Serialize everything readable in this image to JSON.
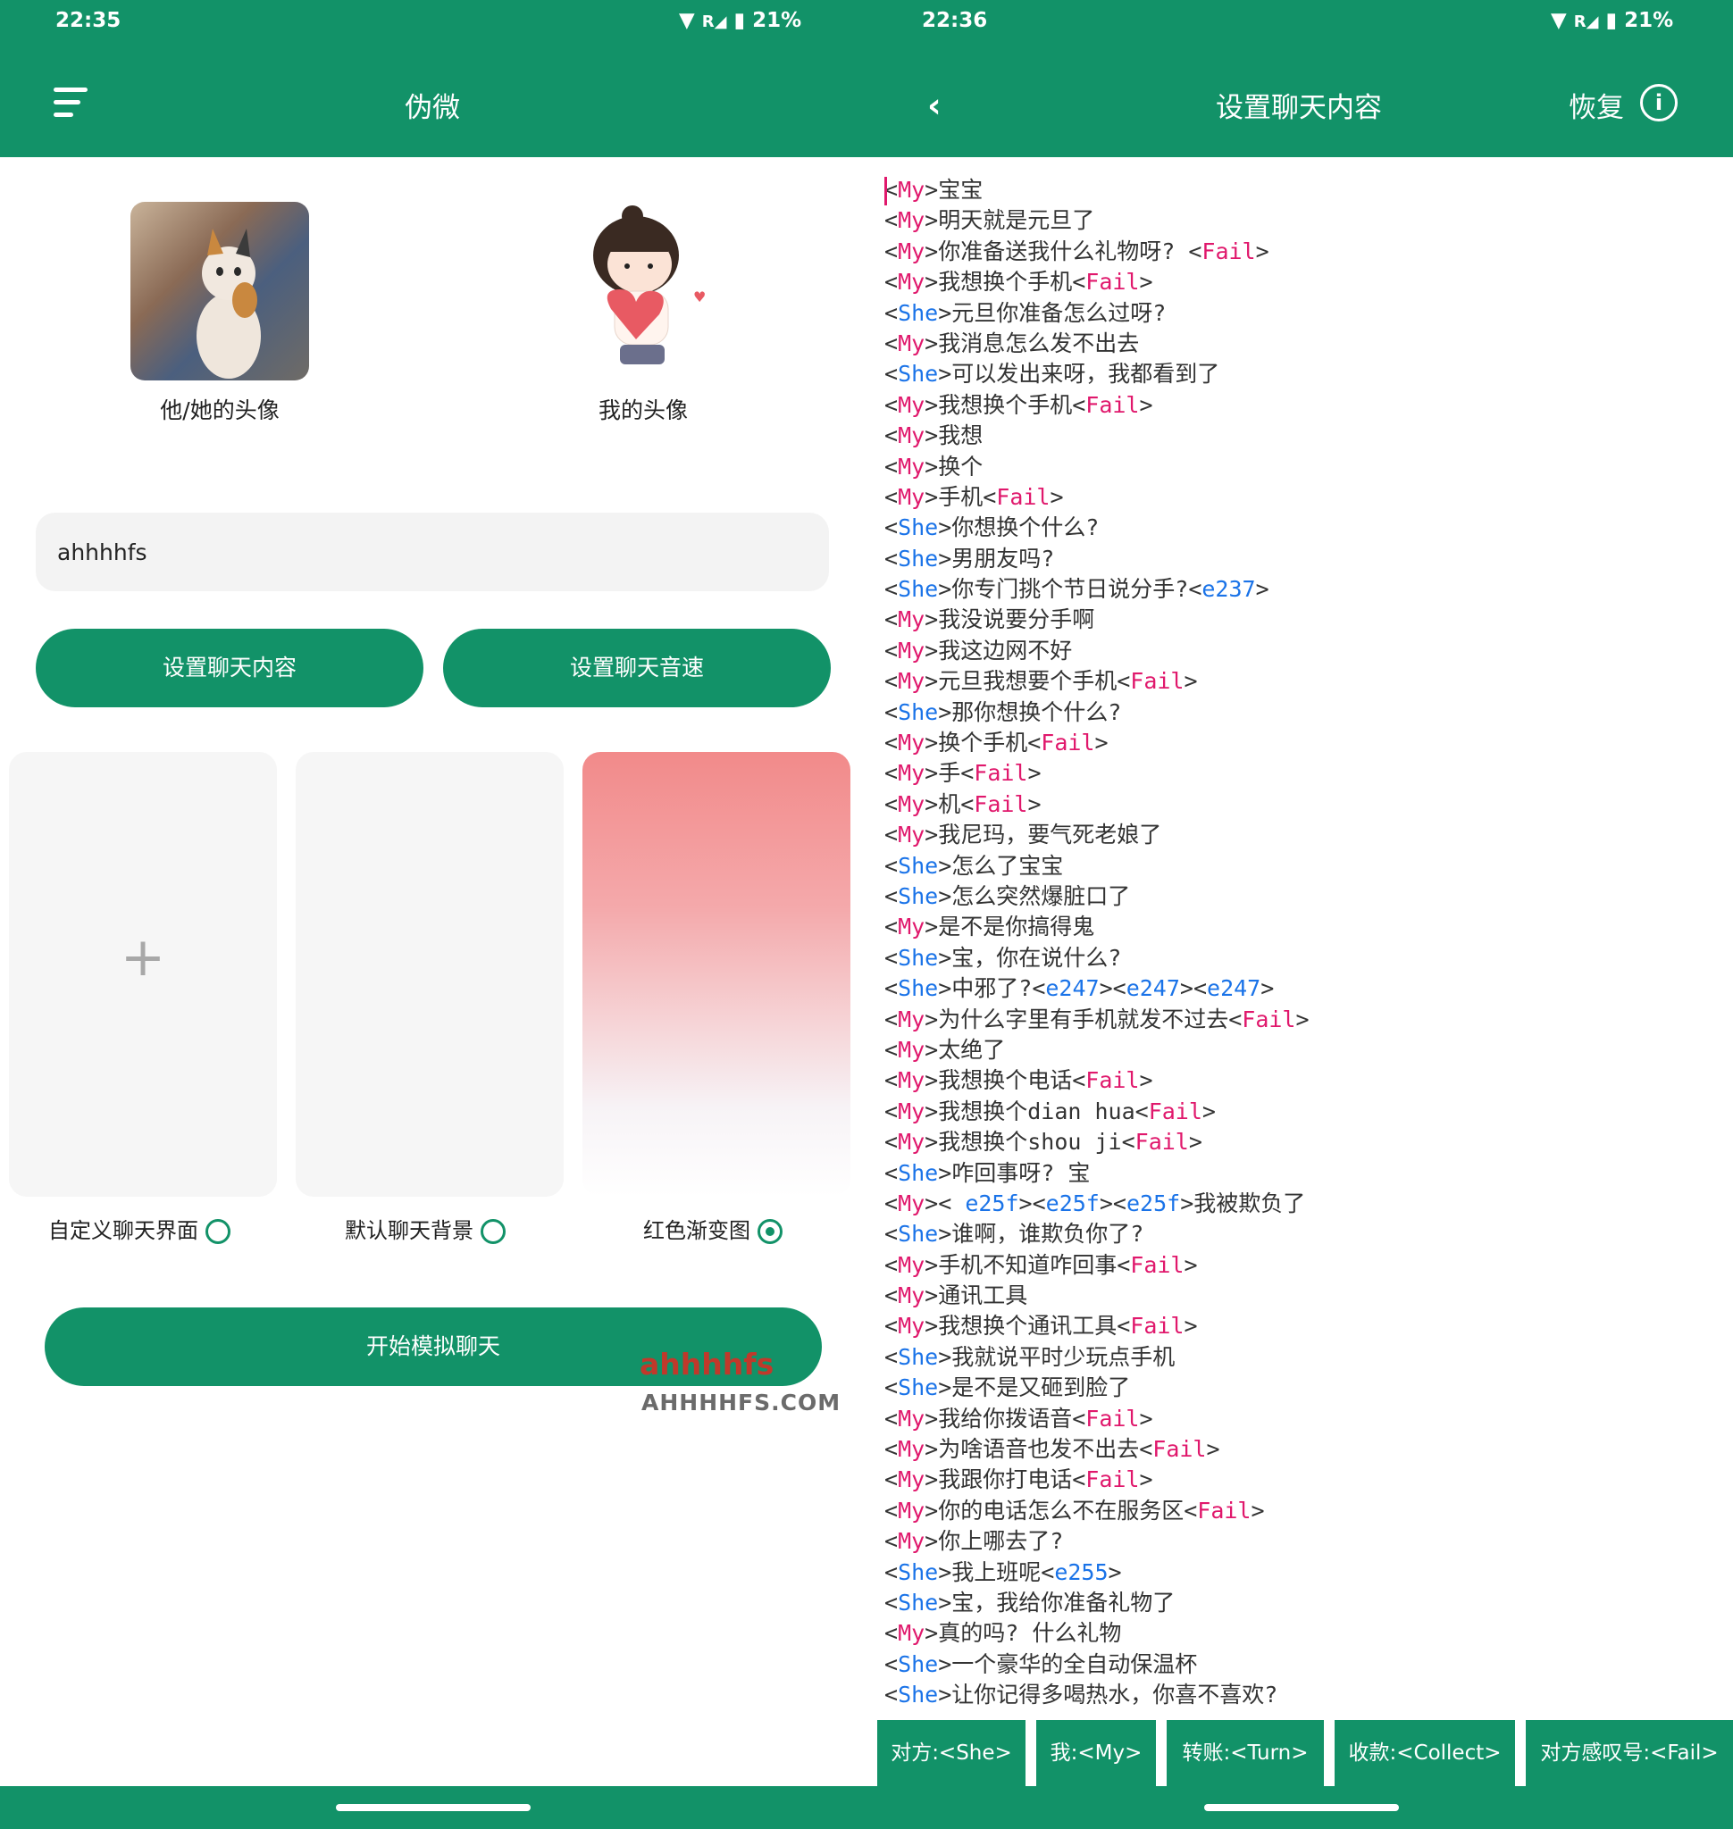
{
  "left": {
    "status_time": "22:35",
    "battery": "21%",
    "title": "伪微",
    "her_avatar_caption": "他/她的头像",
    "my_avatar_caption": "我的头像",
    "name_input_value": "ahhhhfs",
    "btn_set_content": "设置聊天内容",
    "btn_set_speed": "设置聊天音速",
    "card_custom_plus": "+",
    "opt_custom": "自定义聊天界面",
    "opt_default": "默认聊天背景",
    "opt_red": "红色渐变图",
    "selected_option": "红色渐变图",
    "btn_start": "开始模拟聊天",
    "watermark_logo": "ahhhhfs",
    "watermark_url": "AHHHHFS.COM"
  },
  "right": {
    "status_time": "22:36",
    "battery": "21%",
    "title": "设置聊天内容",
    "restore": "恢复",
    "lines": [
      [
        [
          "t",
          "<"
        ],
        [
          "My",
          "My"
        ],
        [
          "t",
          ">宝宝"
        ]
      ],
      [
        [
          "t",
          "<"
        ],
        [
          "My",
          "My"
        ],
        [
          "t",
          ">明天就是元旦了"
        ]
      ],
      [
        [
          "t",
          "<"
        ],
        [
          "My",
          "My"
        ],
        [
          "t",
          ">你准备送我什么礼物呀? <"
        ],
        [
          "Fail",
          "Fail"
        ],
        [
          "t",
          ">"
        ]
      ],
      [
        [
          "t",
          "<"
        ],
        [
          "My",
          "My"
        ],
        [
          "t",
          ">我想换个手机<"
        ],
        [
          "Fail",
          "Fail"
        ],
        [
          "t",
          ">"
        ]
      ],
      [
        [
          "t",
          "<"
        ],
        [
          "She",
          "She"
        ],
        [
          "t",
          ">元旦你准备怎么过呀?"
        ]
      ],
      [
        [
          "t",
          "<"
        ],
        [
          "My",
          "My"
        ],
        [
          "t",
          ">我消息怎么发不出去"
        ]
      ],
      [
        [
          "t",
          "<"
        ],
        [
          "She",
          "She"
        ],
        [
          "t",
          ">可以发出来呀，我都看到了"
        ]
      ],
      [
        [
          "t",
          "<"
        ],
        [
          "My",
          "My"
        ],
        [
          "t",
          ">我想换个手机<"
        ],
        [
          "Fail",
          "Fail"
        ],
        [
          "t",
          ">"
        ]
      ],
      [
        [
          "t",
          "<"
        ],
        [
          "My",
          "My"
        ],
        [
          "t",
          ">我想"
        ]
      ],
      [
        [
          "t",
          "<"
        ],
        [
          "My",
          "My"
        ],
        [
          "t",
          ">换个"
        ]
      ],
      [
        [
          "t",
          "<"
        ],
        [
          "My",
          "My"
        ],
        [
          "t",
          ">手机<"
        ],
        [
          "Fail",
          "Fail"
        ],
        [
          "t",
          ">"
        ]
      ],
      [
        [
          "t",
          "<"
        ],
        [
          "She",
          "She"
        ],
        [
          "t",
          ">你想换个什么?"
        ]
      ],
      [
        [
          "t",
          "<"
        ],
        [
          "She",
          "She"
        ],
        [
          "t",
          ">男朋友吗?"
        ]
      ],
      [
        [
          "t",
          "<"
        ],
        [
          "She",
          "She"
        ],
        [
          "t",
          ">你专门挑个节日说分手?<"
        ],
        [
          "E",
          "e237"
        ],
        [
          "t",
          ">"
        ]
      ],
      [
        [
          "t",
          "<"
        ],
        [
          "My",
          "My"
        ],
        [
          "t",
          ">我没说要分手啊"
        ]
      ],
      [
        [
          "t",
          "<"
        ],
        [
          "My",
          "My"
        ],
        [
          "t",
          ">我这边网不好"
        ]
      ],
      [
        [
          "t",
          "<"
        ],
        [
          "My",
          "My"
        ],
        [
          "t",
          ">元旦我想要个手机<"
        ],
        [
          "Fail",
          "Fail"
        ],
        [
          "t",
          ">"
        ]
      ],
      [
        [
          "t",
          "<"
        ],
        [
          "She",
          "She"
        ],
        [
          "t",
          ">那你想换个什么?"
        ]
      ],
      [
        [
          "t",
          "<"
        ],
        [
          "My",
          "My"
        ],
        [
          "t",
          ">换个手机<"
        ],
        [
          "Fail",
          "Fail"
        ],
        [
          "t",
          ">"
        ]
      ],
      [
        [
          "t",
          "<"
        ],
        [
          "My",
          "My"
        ],
        [
          "t",
          ">手<"
        ],
        [
          "Fail",
          "Fail"
        ],
        [
          "t",
          ">"
        ]
      ],
      [
        [
          "t",
          "<"
        ],
        [
          "My",
          "My"
        ],
        [
          "t",
          ">机<"
        ],
        [
          "Fail",
          "Fail"
        ],
        [
          "t",
          ">"
        ]
      ],
      [
        [
          "t",
          "<"
        ],
        [
          "My",
          "My"
        ],
        [
          "t",
          ">我尼玛，要气死老娘了"
        ]
      ],
      [
        [
          "t",
          "<"
        ],
        [
          "She",
          "She"
        ],
        [
          "t",
          ">怎么了宝宝"
        ]
      ],
      [
        [
          "t",
          "<"
        ],
        [
          "She",
          "She"
        ],
        [
          "t",
          ">怎么突然爆脏口了"
        ]
      ],
      [
        [
          "t",
          "<"
        ],
        [
          "My",
          "My"
        ],
        [
          "t",
          ">是不是你搞得鬼"
        ]
      ],
      [
        [
          "t",
          "<"
        ],
        [
          "She",
          "She"
        ],
        [
          "t",
          ">宝，你在说什么?"
        ]
      ],
      [
        [
          "t",
          "<"
        ],
        [
          "She",
          "She"
        ],
        [
          "t",
          ">中邪了?<"
        ],
        [
          "E",
          "e247"
        ],
        [
          "t",
          "><"
        ],
        [
          "E",
          "e247"
        ],
        [
          "t",
          "><"
        ],
        [
          "E",
          "e247"
        ],
        [
          "t",
          ">"
        ]
      ],
      [
        [
          "t",
          "<"
        ],
        [
          "My",
          "My"
        ],
        [
          "t",
          ">为什么字里有手机就发不过去<"
        ],
        [
          "Fail",
          "Fail"
        ],
        [
          "t",
          ">"
        ]
      ],
      [
        [
          "t",
          "<"
        ],
        [
          "My",
          "My"
        ],
        [
          "t",
          ">太绝了"
        ]
      ],
      [
        [
          "t",
          "<"
        ],
        [
          "My",
          "My"
        ],
        [
          "t",
          ">我想换个电话<"
        ],
        [
          "Fail",
          "Fail"
        ],
        [
          "t",
          ">"
        ]
      ],
      [
        [
          "t",
          "<"
        ],
        [
          "My",
          "My"
        ],
        [
          "t",
          ">我想换个dian hua<"
        ],
        [
          "Fail",
          "Fail"
        ],
        [
          "t",
          ">"
        ]
      ],
      [
        [
          "t",
          "<"
        ],
        [
          "My",
          "My"
        ],
        [
          "t",
          ">我想换个shou ji<"
        ],
        [
          "Fail",
          "Fail"
        ],
        [
          "t",
          ">"
        ]
      ],
      [
        [
          "t",
          "<"
        ],
        [
          "She",
          "She"
        ],
        [
          "t",
          ">咋回事呀? 宝"
        ]
      ],
      [
        [
          "t",
          "<"
        ],
        [
          "My",
          "My"
        ],
        [
          "t",
          ">< "
        ],
        [
          "E",
          "e25f"
        ],
        [
          "t",
          "><"
        ],
        [
          "E",
          "e25f"
        ],
        [
          "t",
          "><"
        ],
        [
          "E",
          "e25f"
        ],
        [
          "t",
          ">我被欺负了"
        ]
      ],
      [
        [
          "t",
          "<"
        ],
        [
          "She",
          "She"
        ],
        [
          "t",
          ">谁啊，谁欺负你了?"
        ]
      ],
      [
        [
          "t",
          "<"
        ],
        [
          "My",
          "My"
        ],
        [
          "t",
          ">手机不知道咋回事<"
        ],
        [
          "Fail",
          "Fail"
        ],
        [
          "t",
          ">"
        ]
      ],
      [
        [
          "t",
          "<"
        ],
        [
          "My",
          "My"
        ],
        [
          "t",
          ">通讯工具"
        ]
      ],
      [
        [
          "t",
          "<"
        ],
        [
          "My",
          "My"
        ],
        [
          "t",
          ">我想换个通讯工具<"
        ],
        [
          "Fail",
          "Fail"
        ],
        [
          "t",
          ">"
        ]
      ],
      [
        [
          "t",
          "<"
        ],
        [
          "She",
          "She"
        ],
        [
          "t",
          ">我就说平时少玩点手机"
        ]
      ],
      [
        [
          "t",
          "<"
        ],
        [
          "She",
          "She"
        ],
        [
          "t",
          ">是不是又砸到脸了"
        ]
      ],
      [
        [
          "t",
          "<"
        ],
        [
          "My",
          "My"
        ],
        [
          "t",
          ">我给你拨语音<"
        ],
        [
          "Fail",
          "Fail"
        ],
        [
          "t",
          ">"
        ]
      ],
      [
        [
          "t",
          "<"
        ],
        [
          "My",
          "My"
        ],
        [
          "t",
          ">为啥语音也发不出去<"
        ],
        [
          "Fail",
          "Fail"
        ],
        [
          "t",
          ">"
        ]
      ],
      [
        [
          "t",
          "<"
        ],
        [
          "My",
          "My"
        ],
        [
          "t",
          ">我跟你打电话<"
        ],
        [
          "Fail",
          "Fail"
        ],
        [
          "t",
          ">"
        ]
      ],
      [
        [
          "t",
          "<"
        ],
        [
          "My",
          "My"
        ],
        [
          "t",
          ">你的电话怎么不在服务区<"
        ],
        [
          "Fail",
          "Fail"
        ],
        [
          "t",
          ">"
        ]
      ],
      [
        [
          "t",
          "<"
        ],
        [
          "My",
          "My"
        ],
        [
          "t",
          ">你上哪去了?"
        ]
      ],
      [
        [
          "t",
          "<"
        ],
        [
          "She",
          "She"
        ],
        [
          "t",
          ">我上班呢<"
        ],
        [
          "E",
          "e255"
        ],
        [
          "t",
          ">"
        ]
      ],
      [
        [
          "t",
          "<"
        ],
        [
          "She",
          "She"
        ],
        [
          "t",
          ">宝，我给你准备礼物了"
        ]
      ],
      [
        [
          "t",
          "<"
        ],
        [
          "My",
          "My"
        ],
        [
          "t",
          ">真的吗? 什么礼物"
        ]
      ],
      [
        [
          "t",
          "<"
        ],
        [
          "She",
          "She"
        ],
        [
          "t",
          ">一个豪华的全自动保温杯"
        ]
      ],
      [
        [
          "t",
          "<"
        ],
        [
          "She",
          "She"
        ],
        [
          "t",
          ">让你记得多喝热水，你喜不喜欢?"
        ]
      ]
    ],
    "chips": [
      "对方:<She>",
      "我:<My>",
      "转账:<Turn>",
      "收款:<Collect>",
      "对方感叹号:<Fail>"
    ]
  },
  "colors": {
    "brand_green": "#129268",
    "my_tag": "#e0186c",
    "she_tag": "#1a73e8"
  },
  "icons": [
    "menu-icon",
    "back-icon",
    "info-icon",
    "wifi-icon",
    "signal-icon",
    "battery-icon",
    "plus-icon"
  ]
}
